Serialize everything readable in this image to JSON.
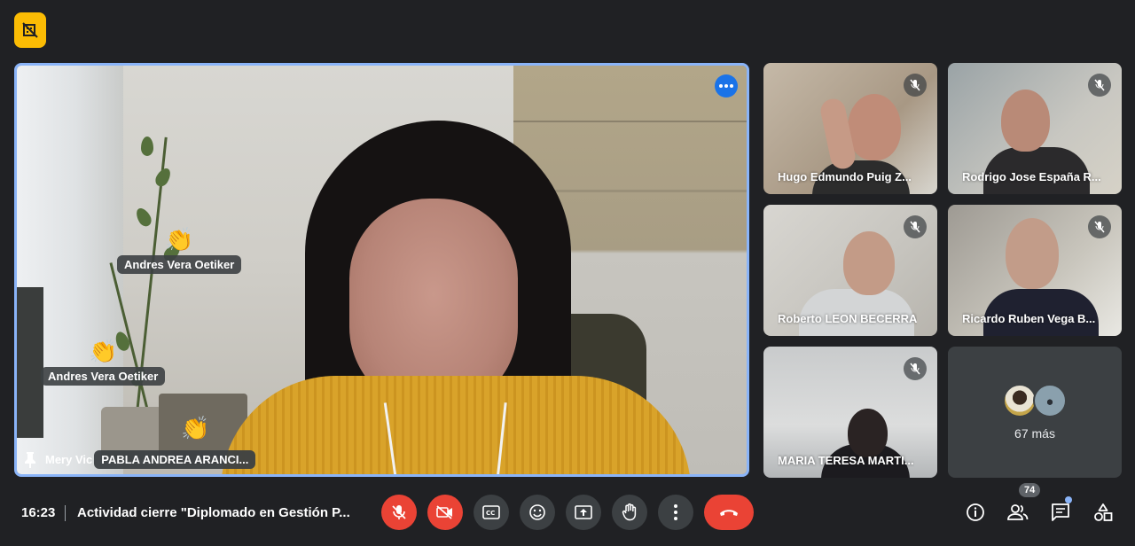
{
  "colors": {
    "background": "#202124",
    "active_border": "#8ab4f8",
    "danger": "#ea4335",
    "control_bg": "#3c4043",
    "badge_yellow": "#fbbc04"
  },
  "main_tile": {
    "pinned_name_partial": "Mery Vic",
    "presenter_name": "PABLA ANDREA ARANCI...",
    "reactions": [
      {
        "emoji": "👏",
        "name": "Andres Vera Oetiker"
      },
      {
        "emoji": "👏",
        "name": "Andres Vera Oetiker"
      },
      {
        "emoji": "👏",
        "name": ""
      }
    ]
  },
  "participants": [
    {
      "name": "Hugo Edmundo Puig Z...",
      "muted": true
    },
    {
      "name": "Rodrigo Jose España R...",
      "muted": true
    },
    {
      "name": "Roberto LEON BECERRA",
      "muted": true
    },
    {
      "name": "Ricardo Ruben Vega B...",
      "muted": true
    },
    {
      "name": "MARIA TERESA MARTI...",
      "muted": true
    }
  ],
  "more_tile": {
    "label": "67 más"
  },
  "bottom_bar": {
    "time": "16:23",
    "meeting_title": "Actividad cierre \"Diplomado en Gestión P...",
    "participant_count": "74"
  },
  "icons": {
    "top_badge": "no-camera-building-icon",
    "more": "more-options-icon",
    "mic": "mic-off-icon",
    "camera": "camera-off-icon",
    "captions": "captions-icon",
    "emoji": "emoji-icon",
    "present": "present-screen-icon",
    "hand": "raise-hand-icon",
    "more_vert": "more-vert-icon",
    "end_call": "end-call-icon",
    "info": "info-icon",
    "people": "people-icon",
    "chat": "chat-icon",
    "activities": "activities-icon"
  }
}
